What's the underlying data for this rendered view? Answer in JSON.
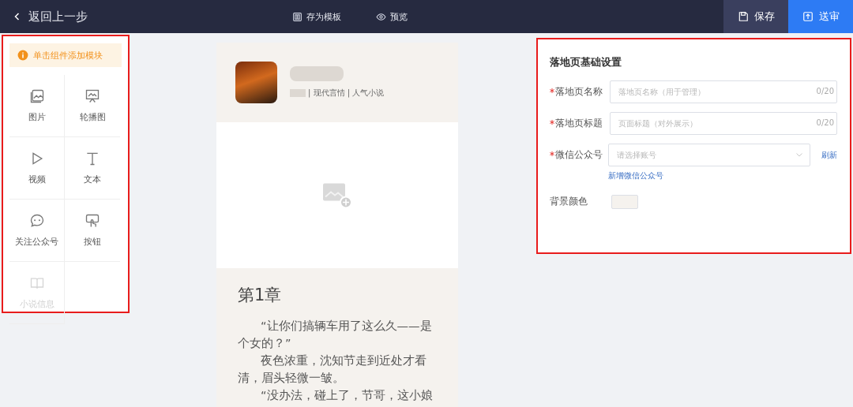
{
  "topbar": {
    "back": "返回上一步",
    "tools": [
      {
        "kind": "template",
        "label": "存为模板"
      },
      {
        "kind": "preview",
        "label": "预览"
      }
    ],
    "actions": [
      {
        "kind": "save",
        "label": "保存"
      },
      {
        "kind": "submit",
        "label": "送审"
      }
    ]
  },
  "palette": {
    "hint": "单击组件添加模块",
    "items": [
      {
        "kind": "image",
        "label": "图片",
        "disabled": false
      },
      {
        "kind": "carousel",
        "label": "轮播图",
        "disabled": false
      },
      {
        "kind": "video",
        "label": "视频",
        "disabled": false
      },
      {
        "kind": "text",
        "label": "文本",
        "disabled": false
      },
      {
        "kind": "follow",
        "label": "关注公众号",
        "disabled": false
      },
      {
        "kind": "button",
        "label": "按钮",
        "disabled": false
      },
      {
        "kind": "novel",
        "label": "小说信息",
        "disabled": true
      }
    ]
  },
  "preview": {
    "book_meta": "| 现代言情 | 人气小说",
    "chapter_title": "第1章",
    "paragraphs": [
      "“让你们搞辆车用了这么久——是个女的？”",
      "夜色浓重，沈知节走到近处才看清，眉头轻微一皱。",
      "“没办法，碰上了，节哥，这小娘"
    ]
  },
  "settings": {
    "title": "落地页基础设置",
    "fields": [
      {
        "kind": "text",
        "label": "落地页名称",
        "required": true,
        "placeholder": "落地页名称（用于管理）",
        "counter": "0/20"
      },
      {
        "kind": "text",
        "label": "落地页标题",
        "required": true,
        "placeholder": "页面标题（对外展示）",
        "counter": "0/20"
      },
      {
        "kind": "select",
        "label": "微信公众号",
        "required": true,
        "placeholder": "请选择账号",
        "action": "刷新",
        "helper": "新增微信公众号"
      },
      {
        "kind": "color",
        "label": "背景颜色",
        "required": false,
        "color": "#f5f2ee"
      }
    ]
  }
}
